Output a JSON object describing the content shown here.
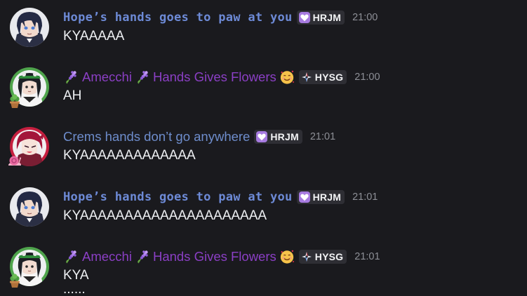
{
  "colors": {
    "background": "#1a1a1e",
    "name_pixel_blue": "#6d8ad6",
    "name_purple": "#8b3fc5",
    "name_blue": "#6e8dcc",
    "tag_bg": "#2e2e34",
    "timestamp": "#8d8f96",
    "message_text": "#eef0f3"
  },
  "messages": [
    {
      "author": "Hope’s hands goes to paw at you",
      "tag": "HRJM",
      "tag_icon": "purple-heart-icon",
      "time": "21:00",
      "text": "KYAAAAA"
    },
    {
      "author": "Amecchi",
      "author_suffix": "Hands Gives Flowers",
      "tag": "HYSG",
      "tag_icon": "compass-star-icon",
      "emojis": [
        "hyacinth-flower-icon",
        "hyacinth-flower-icon",
        "smiling-hearts-face-icon"
      ],
      "time": "21:00",
      "text": "AH"
    },
    {
      "author": "Crems hands don’t go anywhere",
      "tag": "HRJM",
      "tag_icon": "purple-heart-icon",
      "time": "21:01",
      "text": "KYAAAAAAAAAAAAA"
    },
    {
      "author": "Hope’s hands goes to paw at you",
      "tag": "HRJM",
      "tag_icon": "purple-heart-icon",
      "time": "21:01",
      "text": "KYAAAAAAAAAAAAAAAAAAAAA"
    },
    {
      "author": "Amecchi",
      "author_suffix": "Hands Gives Flowers",
      "tag": "HYSG",
      "tag_icon": "compass-star-icon",
      "emojis": [
        "hyacinth-flower-icon",
        "hyacinth-flower-icon",
        "smiling-hearts-face-icon"
      ],
      "time": "21:01",
      "text": "KYA"
    }
  ],
  "partial_next_line": "......"
}
